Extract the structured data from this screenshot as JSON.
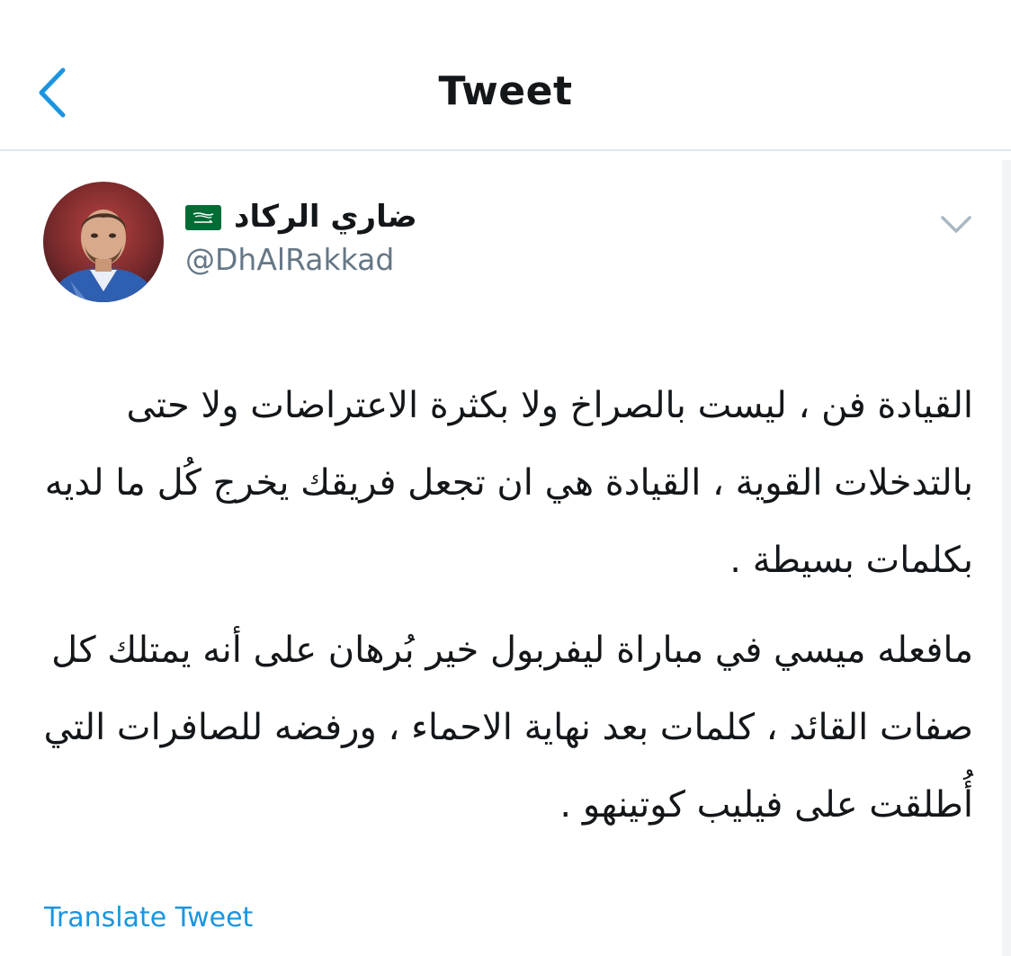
{
  "header": {
    "title": "Tweet",
    "back_icon": "chevron-left-icon"
  },
  "author": {
    "display_name": "ضاري الركاد",
    "flag_icon": "saudi-arabia-flag-icon",
    "handle": "@DhAlRakkad",
    "avatar_icon": "profile-avatar"
  },
  "tweet": {
    "caret_icon": "chevron-down-icon",
    "paragraphs": [
      "القيادة فن ، ليست بالصراخ ولا بكثرة الاعتراضات ولا حتى بالتدخلات القوية ، القيادة هي ان تجعل فريقك يخرج كُل ما لديه بكلمات بسيطة .",
      "مافعله ميسي في مباراة ليفربول خير بُرهان على أنه يمتلك كل صفات القائد ، كلمات بعد نهاية الاحماء ، ورفضه للصافرات التي أُطلقت على فيليب كوتينهو ."
    ],
    "translate_label": "Translate Tweet"
  },
  "colors": {
    "accent": "#1b95e0",
    "text": "#14171a",
    "secondary_text": "#657786",
    "divider": "#e1e8ed",
    "flag_green": "#006c35"
  }
}
